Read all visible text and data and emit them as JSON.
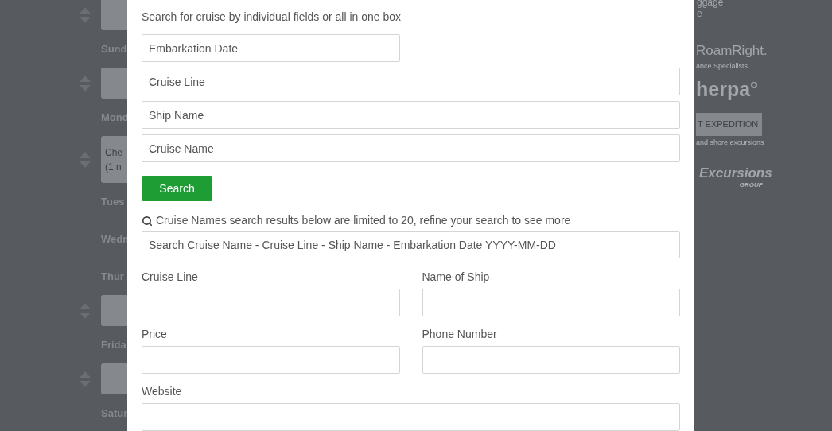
{
  "background": {
    "days": [
      {
        "kind": "card",
        "label": "Sund"
      },
      {
        "kind": "card",
        "label": "Mond"
      },
      {
        "kind": "card",
        "label": "Tues",
        "card_lines": [
          "Che",
          "(1 n"
        ]
      },
      {
        "kind": "plain",
        "label": "Wedn"
      },
      {
        "kind": "plain",
        "label": "Thur"
      },
      {
        "kind": "card",
        "label": "Frida"
      },
      {
        "kind": "card",
        "label": "Satur"
      }
    ],
    "sponsors": {
      "baggage_lines": [
        "ggage",
        "e"
      ],
      "roamright": "RoamRight.",
      "roamright_tagline": "ance Specialists",
      "sherpa": "herpa°",
      "expedition_button": "T EXPEDITION",
      "expedition_tagline": "and shore excursions",
      "excursions": "Excursions",
      "excursions_group": "GROUP"
    }
  },
  "modal": {
    "intro": "Search for cruise by individual fields or all in one box",
    "fields": [
      {
        "placeholder": "Embarkation Date",
        "kind": "short"
      },
      {
        "placeholder": "Cruise Line",
        "kind": "long"
      },
      {
        "placeholder": "Ship Name",
        "kind": "long"
      },
      {
        "placeholder": "Cruise Name",
        "kind": "long"
      }
    ],
    "search_button": "Search",
    "results_note": "Cruise Names search results below are limited to 20, refine your search to see more",
    "combined_search": {
      "placeholder": "Search Cruise Name - Cruise Line - Ship Name - Embarkation Date YYYY-MM-DD"
    },
    "form_fields": [
      {
        "label": "Cruise Line",
        "kind": "short"
      },
      {
        "label": "Name of Ship",
        "kind": "short"
      },
      {
        "label": "Price",
        "kind": "short"
      },
      {
        "label": "Phone Number",
        "kind": "short"
      },
      {
        "label": "Website",
        "kind": "long"
      }
    ]
  }
}
